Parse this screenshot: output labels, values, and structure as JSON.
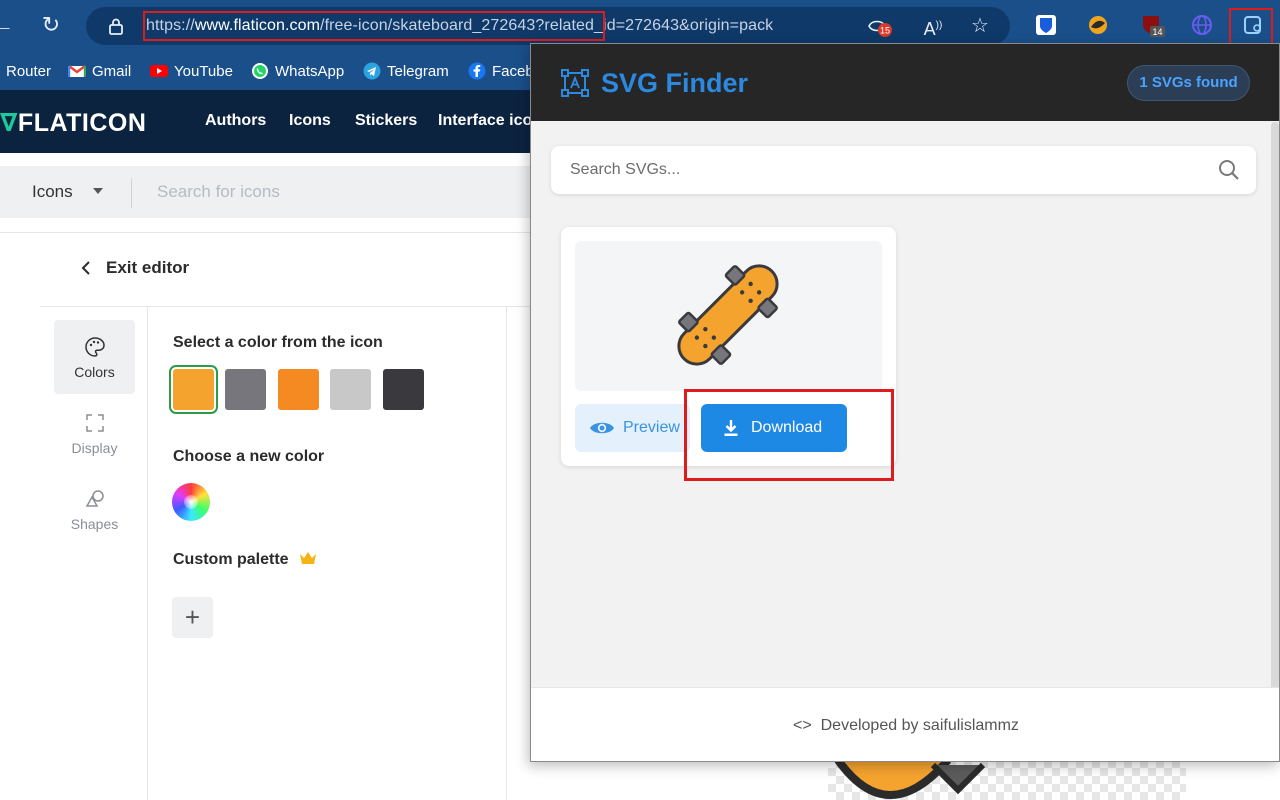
{
  "browser": {
    "url_scheme": "https://",
    "url_host": "www.flaticon.com",
    "url_path": "/free-icon/skateboard_272643?related_id=272643&origin=pack",
    "tracker_badge": "15",
    "ext_badge": "14"
  },
  "bookmarks": [
    {
      "label": "Router",
      "icon": "router-icon",
      "color": ""
    },
    {
      "label": "Gmail",
      "icon": "gmail-icon",
      "color": "#ea4335"
    },
    {
      "label": "YouTube",
      "icon": "youtube-icon",
      "color": "#ff0000"
    },
    {
      "label": "WhatsApp",
      "icon": "whatsapp-icon",
      "color": "#25d366"
    },
    {
      "label": "Telegram",
      "icon": "telegram-icon",
      "color": "#2aa3df"
    },
    {
      "label": "Faceb",
      "icon": "facebook-icon",
      "color": "#1877f2"
    }
  ],
  "flaticon": {
    "logo": "FLATICON",
    "nav": [
      "Authors",
      "Icons",
      "Stickers",
      "Interface ico"
    ],
    "search_type": "Icons",
    "search_placeholder": "Search for icons",
    "exit_editor": "Exit editor",
    "tools": [
      "Colors",
      "Display",
      "Shapes"
    ],
    "select_color_title": "Select a color from the icon",
    "swatches": [
      "#f5a32f",
      "#77767c",
      "#f68a22",
      "#c8c8c8",
      "#3a3a3e"
    ],
    "choose_color_title": "Choose a new color",
    "custom_palette_title": "Custom palette"
  },
  "popup": {
    "title": "SVG Finder",
    "found_badge": "1 SVGs found",
    "search_placeholder": "Search SVGs...",
    "preview_label": "Preview",
    "download_label": "Download",
    "footer": "Developed by saifulislammz"
  },
  "colors": {
    "browser_bar": "#1a4f8a",
    "flaticon_nav": "#0c2340",
    "accent_blue": "#1e88e5",
    "highlight_red": "#e01b1b"
  }
}
